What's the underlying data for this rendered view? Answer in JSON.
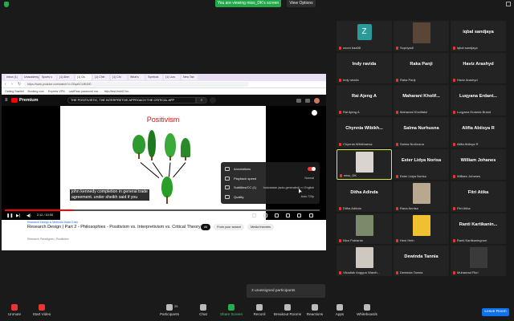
{
  "top": {
    "banner": "You are viewing miss_DK's screen",
    "view_options": "View Options"
  },
  "browser": {
    "tabs": [
      "Inbox (1)",
      "Unacademy",
      "Sports s",
      "(1) Ahm",
      "(1) Gs",
      "(1) Chin",
      "(1) Chi",
      "What's",
      "Symbols",
      "(1) Liza",
      "New Tab"
    ],
    "url": "https://www.youtube.com/watch?v=ZKqaKCU8UN0",
    "bookmarks": [
      "Getting Started",
      "Booking.com",
      "Express VPN",
      "LastPass password ma...",
      "http://test-fedr62.bo..."
    ]
  },
  "youtube": {
    "premium_label": "Premium",
    "search_text": "THE POSITIVISTIC, THE INTERPRETIVE APPROACH THE CRITICAL APP",
    "slide_title": "Positivism",
    "caption_line1": "john kennedy completion in general trade",
    "caption_line2": "agreement. under sheikh said if you",
    "settings": [
      {
        "label": "Annotations",
        "value": ""
      },
      {
        "label": "Playback speed",
        "value": "Normal"
      },
      {
        "label": "Subtitles/CC (1)",
        "value": "Indonesian (auto-generated) >> English"
      },
      {
        "label": "Quality",
        "value": "Auto 720p"
      }
    ],
    "time": "2:12 / 10:00",
    "progress_fraction": 0.22,
    "channel": "Research Design & Methods Made Easy",
    "video_title": "Research Design | Part 2 - Philosophies - Positivism vs. Interpretivism vs. Critical Theory",
    "chips": [
      "All",
      "From your search",
      "Media theories"
    ],
    "sub_text": "Research Paradigms • Positivism"
  },
  "participants": [
    {
      "type": "avatar",
      "initial": "Z",
      "sub": "zoom baa08"
    },
    {
      "type": "photo",
      "sub": "Supriyadi",
      "color": "#5a4636"
    },
    {
      "type": "name",
      "name": "iqbal sandjaya",
      "sub": "iqbal sandjaya"
    },
    {
      "type": "name",
      "name": "Indy ravida",
      "sub": "Indy ravida"
    },
    {
      "type": "name",
      "name": "Raka Panji",
      "sub": "Raka Panji"
    },
    {
      "type": "name",
      "name": "Haviz Arashyd",
      "sub": "Haviz Arashyd"
    },
    {
      "type": "name",
      "name": "Rai Ajeng A",
      "sub": "Rai Ajeng A"
    },
    {
      "type": "name",
      "name": "Maharani Kholif...",
      "sub": "Maharani Kholifatul"
    },
    {
      "type": "name",
      "name": "Luqyana Erdant...",
      "sub": "Luqyana Erdanta Brand"
    },
    {
      "type": "name",
      "name": "Chynnia Wibikh...",
      "sub": "Chynnia Wibikhansa"
    },
    {
      "type": "name",
      "name": "Salma Nurhusna",
      "sub": "Salma Nurhusna"
    },
    {
      "type": "name",
      "name": "Alifia Abiisya R",
      "sub": "Alifia Abiisya R"
    },
    {
      "type": "photo",
      "sub": "miss_DK",
      "color": "#d9d4cf",
      "highlight": true
    },
    {
      "type": "name",
      "name": "Ester Lidya Norisa",
      "sub": "Ester Lidya Norisa"
    },
    {
      "type": "name",
      "name": "William Johanes",
      "sub": "William Johanes"
    },
    {
      "type": "name",
      "name": "Ditha Adinda",
      "sub": "Ditha Adinda"
    },
    {
      "type": "photo",
      "sub": "Rana Annisa",
      "color": "#b8a890"
    },
    {
      "type": "name",
      "name": "Fitri Atika",
      "sub": "Fitri Atika"
    },
    {
      "type": "photo",
      "sub": "Nico Pubianto",
      "color": "#7a8a6a"
    },
    {
      "type": "photo",
      "sub": "Heni Hein",
      "color": "#f0c030"
    },
    {
      "type": "name",
      "name": "Ranti Kartikanin...",
      "sub": "Ranti Kartikaningrum"
    },
    {
      "type": "photo",
      "sub": "Vikadiah Anggun Wardh...",
      "color": "#cfc8c0"
    },
    {
      "type": "name",
      "name": "Dewinda Tannia",
      "sub": "Dewinda Tannia"
    },
    {
      "type": "photo",
      "sub": "Muhamad Fikri",
      "color": "#3a3a3a"
    }
  ],
  "unassigned": "3 unassigned participants",
  "toolbar": {
    "unmute": "Unmute",
    "start_video": "Start Video",
    "participants": "Participants",
    "participants_count": "25",
    "chat": "Chat",
    "share_screen": "Share Screen",
    "record": "Record",
    "breakout": "Breakout Rooms",
    "reactions": "Reactions",
    "apps": "Apps",
    "whiteboards": "Whiteboards",
    "leave": "Leave Room"
  },
  "colors": {
    "zoom_green": "#22a84a",
    "leave_blue": "#0e72ed",
    "yt_red": "#ff0000",
    "highlight": "#d6e84a"
  }
}
